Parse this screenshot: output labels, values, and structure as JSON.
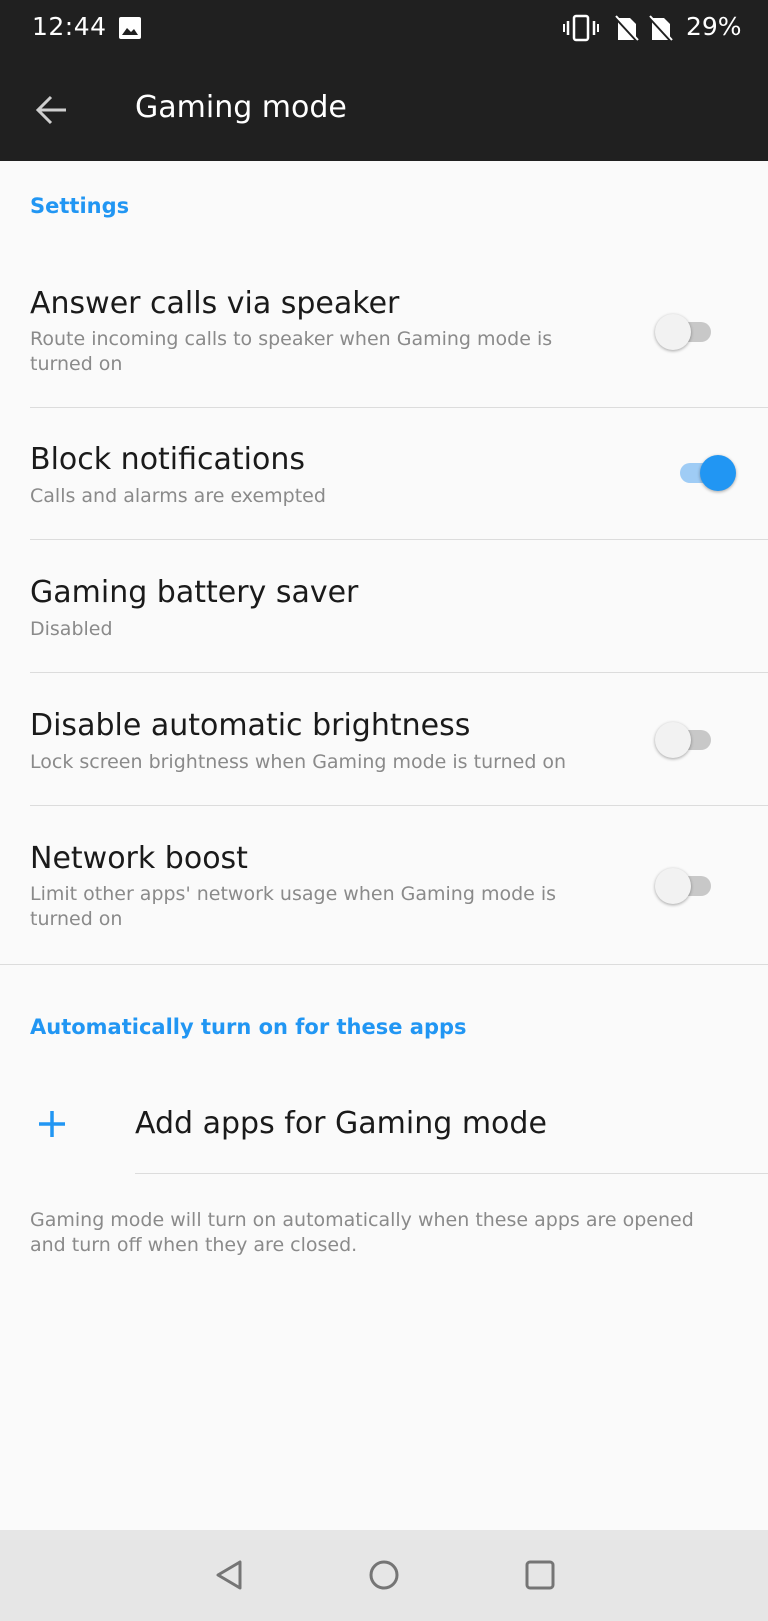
{
  "status_bar": {
    "time": "12:44",
    "battery": "29%",
    "icons": [
      "image-icon",
      "vibrate-icon",
      "no-sim-icon",
      "no-sim-icon"
    ]
  },
  "app_bar": {
    "title": "Gaming mode",
    "back_icon": "back-arrow-icon"
  },
  "settings_section": {
    "header": "Settings",
    "items": [
      {
        "title": "Answer calls via speaker",
        "subtitle": "Route incoming calls to speaker when Gaming mode is turned on",
        "toggle": false
      },
      {
        "title": "Block notifications",
        "subtitle": "Calls and alarms are exempted",
        "toggle": true
      },
      {
        "title": "Gaming battery saver",
        "subtitle": "Disabled"
      },
      {
        "title": "Disable automatic brightness",
        "subtitle": "Lock screen brightness when Gaming mode is turned on",
        "toggle": false
      },
      {
        "title": "Network boost",
        "subtitle": "Limit other apps' network usage when Gaming mode is turned on",
        "toggle": false
      }
    ]
  },
  "apps_section": {
    "header": "Automatically turn on for these apps",
    "add_label": "Add apps for Gaming mode",
    "footnote": "Gaming mode will turn on automatically when these apps are opened and turn off when they are closed."
  },
  "nav_bar": {
    "buttons": [
      "back-triangle-icon",
      "home-circle-icon",
      "recents-square-icon"
    ]
  },
  "colors": {
    "accent": "#2196f3",
    "bar": "#202020",
    "background": "#fafafa",
    "nav_bar": "#e6e6e6"
  }
}
